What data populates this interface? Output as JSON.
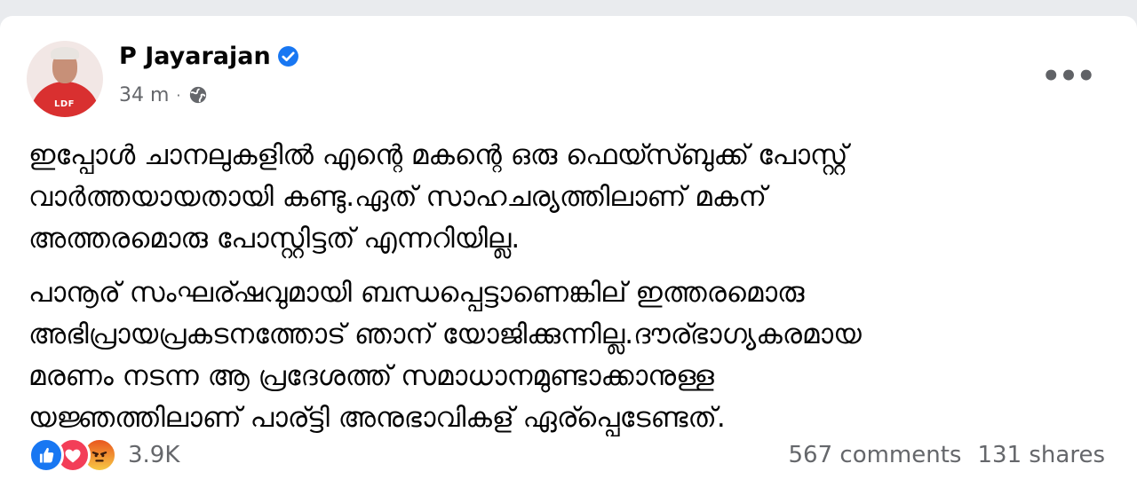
{
  "post": {
    "author": "P Jayarajan",
    "timestamp": "34 m",
    "audience_icon": "globe-icon",
    "verified_icon": "verified-badge-icon",
    "avatar_badge": "LDF",
    "menu_icon": "more-options-icon",
    "paragraph_1_lines": [
      "ഇപ്പോൾ ചാനലുകളിൽ എന്റെ മകന്റെ ഒരു ഫെയ്സ്ബുക്ക് പോസ്റ്റ്",
      "വാർത്തയായതായി കണ്ടു.ഏത് സാഹചര്യത്തിലാണ് മകന്",
      "അത്തരമൊരു പോസ്റ്റിട്ടത് എന്നറിയില്ല."
    ],
    "paragraph_2_lines": [
      "പാനൂര് സംഘര്ഷവുമായി ബന്ധപ്പെട്ടാണെങ്കില് ഇത്തരമൊരു",
      "അഭിപ്രായപ്രകടനത്തോട് ഞാന് യോജിക്കുന്നില്ല.ദൗര്ഭാഗ്യകരമായ",
      "മരണം നടന്ന ആ പ്രദേശത്ത് സമാധാനമുണ്ടാക്കാനുള്ള",
      "യജ്ഞത്തിലാണ് പാര്ട്ടി അനുഭാവികള് ഏര്പ്പെടേണ്ടത്."
    ]
  },
  "reactions": {
    "icons": [
      "like-reaction-icon",
      "love-reaction-icon",
      "angry-reaction-icon"
    ],
    "count": "3.9K"
  },
  "engagement": {
    "comments": "567 comments",
    "shares": "131 shares"
  },
  "colors": {
    "brand_blue": "#1877f2",
    "love_red": "#f33e58",
    "secondary_text": "#65676b",
    "primary_text": "#050505"
  }
}
